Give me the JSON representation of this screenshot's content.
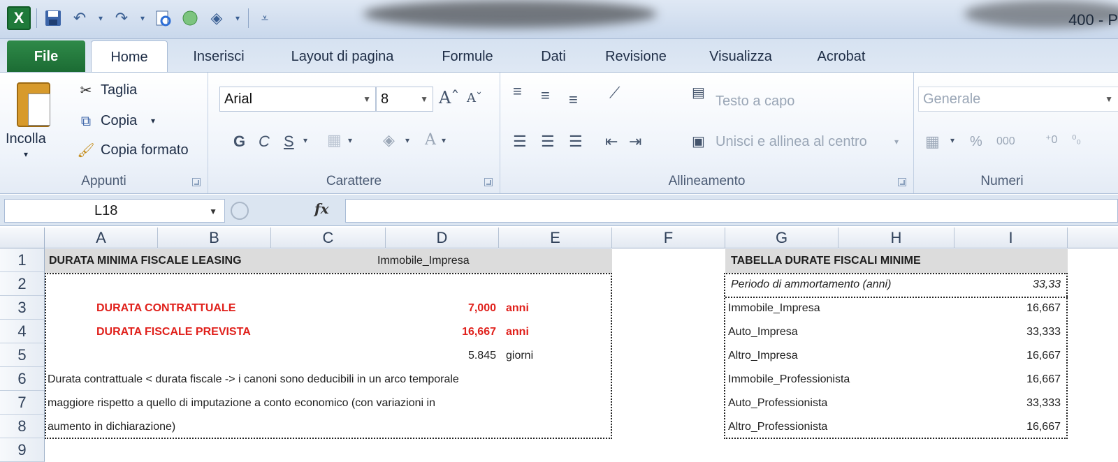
{
  "app": {
    "window_title": "400 - P",
    "logo": "X"
  },
  "tabs": [
    {
      "label": "File"
    },
    {
      "label": "Home"
    },
    {
      "label": "Inserisci"
    },
    {
      "label": "Layout di pagina"
    },
    {
      "label": "Formule"
    },
    {
      "label": "Dati"
    },
    {
      "label": "Revisione"
    },
    {
      "label": "Visualizza"
    },
    {
      "label": "Acrobat"
    }
  ],
  "ribbon": {
    "clipboard": {
      "paste": "Incolla",
      "cut": "Taglia",
      "copy": "Copia",
      "format_painter": "Copia formato",
      "group": "Appunti"
    },
    "font": {
      "font_name": "Arial",
      "font_size": "8",
      "bold": "G",
      "italic": "C",
      "underline": "S",
      "group": "Carattere"
    },
    "alignment": {
      "wrap_text": "Testo a capo",
      "merge_center": "Unisci e allinea al centro",
      "group": "Allineamento"
    },
    "number": {
      "format": "Generale",
      "percent": "%",
      "thousands": "000",
      "group": "Numeri"
    }
  },
  "formula_bar": {
    "name_box": "L18",
    "fx": "fx",
    "formula": ""
  },
  "columns": [
    "A",
    "B",
    "C",
    "D",
    "E",
    "F",
    "G",
    "H",
    "I"
  ],
  "rows": [
    "1",
    "2",
    "3",
    "4",
    "5",
    "6",
    "7",
    "8",
    "9"
  ],
  "sheet": {
    "title_left": "DURATA MINIMA FISCALE LEASING",
    "selected_type": "Immobile_Impresa",
    "durata_contrattuale_label": "DURATA CONTRATTUALE",
    "durata_contrattuale_value": "7,000",
    "durata_contrattuale_unit": "anni",
    "durata_fiscale_label": "DURATA FISCALE PREVISTA",
    "durata_fiscale_value": "16,667",
    "durata_fiscale_unit": "anni",
    "giorni_value": "5.845",
    "giorni_unit": "giorni",
    "note_lines": [
      "Durata contrattuale < durata fiscale -> i canoni sono deducibili in un arco temporale",
      "maggiore rispetto a quello di imputazione a conto economico (con variazioni in",
      "aumento in dichiarazione)"
    ],
    "table_title": "TABELLA DURATE FISCALI MINIME",
    "periodo_label": "Periodo di ammortamento (anni)",
    "periodo_value": "33,33",
    "table_rows": [
      {
        "name": "Immobile_Impresa",
        "value": "16,667"
      },
      {
        "name": "Auto_Impresa",
        "value": "33,333"
      },
      {
        "name": "Altro_Impresa",
        "value": "16,667"
      },
      {
        "name": "Immobile_Professionista",
        "value": "16,667"
      },
      {
        "name": "Auto_Professionista",
        "value": "33,333"
      },
      {
        "name": "Altro_Professionista",
        "value": "16,667"
      }
    ]
  },
  "icons": [
    "excel-logo-icon",
    "save-icon",
    "undo-icon",
    "redo-icon",
    "print-preview-icon",
    "fill-color-icon",
    "customize-qat-icon"
  ]
}
